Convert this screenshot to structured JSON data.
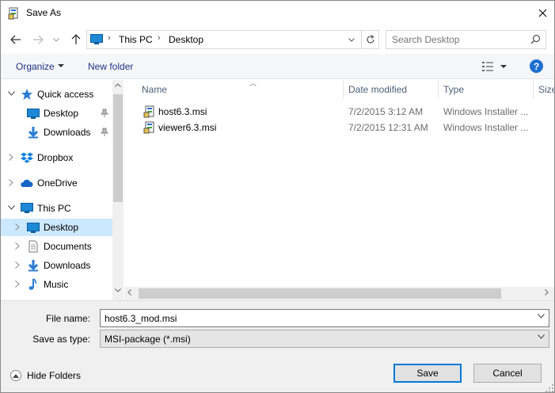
{
  "window": {
    "title": "Save As"
  },
  "toolbar": {
    "breadcrumbs": [
      "This PC",
      "Desktop"
    ],
    "search_placeholder": "Search Desktop"
  },
  "commands": {
    "organize": "Organize",
    "new_folder": "New folder",
    "help": "?"
  },
  "nav": {
    "items": [
      {
        "label": "Quick access",
        "icon": "star-icon"
      },
      {
        "label": "Desktop",
        "icon": "desktop-icon",
        "pinned": true
      },
      {
        "label": "Downloads",
        "icon": "download-arrow-icon",
        "pinned": true
      },
      {
        "label": "Dropbox",
        "icon": "dropbox-icon"
      },
      {
        "label": "OneDrive",
        "icon": "cloud-icon"
      },
      {
        "label": "This PC",
        "icon": "computer-icon"
      },
      {
        "label": "Desktop",
        "icon": "desktop-icon",
        "selected": true
      },
      {
        "label": "Documents",
        "icon": "document-icon"
      },
      {
        "label": "Downloads",
        "icon": "download-arrow-icon"
      },
      {
        "label": "Music",
        "icon": "music-note-icon"
      }
    ]
  },
  "files": {
    "columns": [
      "Name",
      "Date modified",
      "Type",
      "Size"
    ],
    "rows": [
      {
        "name": "host6.3.msi",
        "date": "7/2/2015 3:12 AM",
        "type": "Windows Installer ..."
      },
      {
        "name": "viewer6.3.msi",
        "date": "7/2/2015 12:31 AM",
        "type": "Windows Installer ..."
      }
    ]
  },
  "form": {
    "filename_label": "File name:",
    "filename_value": "host6.3_mod.msi",
    "type_label": "Save as type:",
    "type_value": "MSI-package (*.msi)"
  },
  "footer": {
    "hide_folders": "Hide Folders",
    "save": "Save",
    "cancel": "Cancel"
  }
}
